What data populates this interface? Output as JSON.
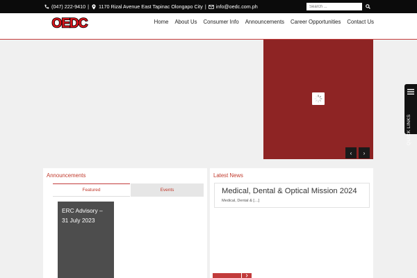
{
  "topbar": {
    "phone": "(047) 222-9410",
    "address": "1170 Rizal Avenue East Tapinac Olongapo City",
    "email": "info@oedc.com.ph",
    "separator": "|",
    "search_placeholder": "Search ...",
    "icons": {
      "phone": "phone-icon",
      "location": "map-pin-icon",
      "email": "envelope-icon",
      "search": "search-icon"
    }
  },
  "header": {
    "logo_text": "OEDC",
    "nav": [
      "Home",
      "About Us",
      "Consumer Info",
      "Announcements",
      "Career Opportunities",
      "Contact Us"
    ]
  },
  "slider": {
    "prev": "‹",
    "next": "›",
    "colors": {
      "slide": "#8e2424",
      "controls": "#1a1a1a"
    }
  },
  "quick_links": {
    "label": "QUICK LINKS",
    "icon": "hamburger-icon"
  },
  "announcements": {
    "title": "Announcements",
    "tabs": [
      "Featured",
      "Events"
    ],
    "active_tab": "Featured",
    "featured_item": "ERC Advisory – 31 July 2023"
  },
  "latest_news": {
    "title": "Latest News",
    "headline": "Medical, Dental & Optical Mission 2024",
    "excerpt": "Medical, Dental & […]",
    "read_more_icon": "chevron-right-icon"
  },
  "colors": {
    "accent": "#c0392b",
    "dark": "#0b0b0b",
    "background": "#f0f0f0"
  }
}
